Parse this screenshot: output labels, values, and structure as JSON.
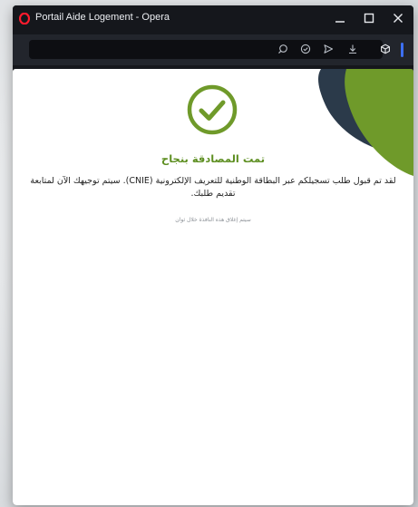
{
  "window": {
    "title": "Portail Aide Logement - Opera",
    "controls": {
      "minimize": "minimize-icon",
      "maximize": "maximize-icon",
      "close": "close-icon"
    }
  },
  "toolbar": {
    "address_value": "",
    "icons": [
      "zoom-icon",
      "shield-icon",
      "send-icon",
      "download-icon",
      "cube-icon"
    ]
  },
  "content": {
    "status_icon": "check-circle-icon",
    "title": "تمت المصادقة بنجاح",
    "message": "لقد تم قبول طلب تسجيلكم عبر البطاقة الوطنية للتعريف الإلكترونية (CNIE). سيتم توجيهك الآن لمتابعة تقديم طلبك.",
    "closing_note": "سيتم إغلاق هذه النافذة خلال ثوان"
  },
  "colors": {
    "accent_green": "#6f9a2a",
    "title_green": "#5e8f22",
    "dark_navy": "#2b3a4a",
    "opera_red": "#ff1b2d",
    "accent_blue": "#3d6ff2"
  }
}
